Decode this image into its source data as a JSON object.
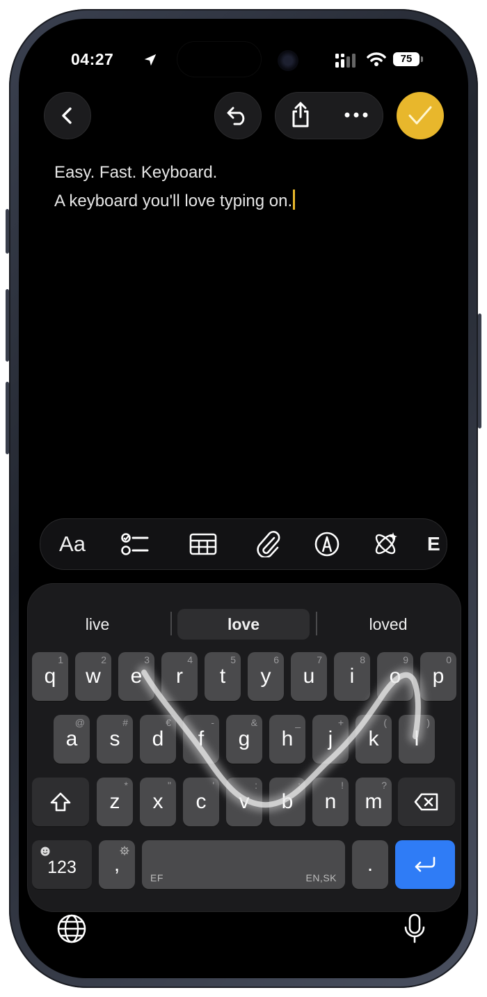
{
  "status_bar": {
    "time": "04:27",
    "battery": "75"
  },
  "nav": {
    "back_label": "Back",
    "undo_label": "Undo",
    "share_label": "Share",
    "more_label": "More",
    "done_label": "Done"
  },
  "note": {
    "line1": "Easy. Fast. Keyboard.",
    "line2": "A keyboard you'll love typing on."
  },
  "format_toolbar": {
    "text_style": "Aa",
    "items": [
      "checklist-icon",
      "table-icon",
      "attachment-icon",
      "markup-icon",
      "apple-intelligence-icon",
      "more-cut-icon"
    ]
  },
  "suggestions": [
    {
      "text": "live",
      "selected": false
    },
    {
      "text": "love",
      "selected": true
    },
    {
      "text": "loved",
      "selected": false
    }
  ],
  "keyboard": {
    "row1": [
      {
        "k": "q",
        "alt": "1"
      },
      {
        "k": "w",
        "alt": "2"
      },
      {
        "k": "e",
        "alt": "3"
      },
      {
        "k": "r",
        "alt": "4"
      },
      {
        "k": "t",
        "alt": "5"
      },
      {
        "k": "y",
        "alt": "6"
      },
      {
        "k": "u",
        "alt": "7"
      },
      {
        "k": "i",
        "alt": "8"
      },
      {
        "k": "o",
        "alt": "9"
      },
      {
        "k": "p",
        "alt": "0"
      }
    ],
    "row2": [
      {
        "k": "a",
        "alt": "@"
      },
      {
        "k": "s",
        "alt": "#"
      },
      {
        "k": "d",
        "alt": "€"
      },
      {
        "k": "f",
        "alt": "-"
      },
      {
        "k": "g",
        "alt": "&"
      },
      {
        "k": "h",
        "alt": "_"
      },
      {
        "k": "j",
        "alt": "+"
      },
      {
        "k": "k",
        "alt": "("
      },
      {
        "k": "l",
        "alt": ")"
      }
    ],
    "row3": [
      {
        "k": "z",
        "alt": "*"
      },
      {
        "k": "x",
        "alt": "\""
      },
      {
        "k": "c",
        "alt": "'"
      },
      {
        "k": "v",
        "alt": ":"
      },
      {
        "k": "b",
        "alt": ";"
      },
      {
        "k": "n",
        "alt": "!"
      },
      {
        "k": "m",
        "alt": "?"
      }
    ],
    "numbers_label": "123",
    "comma_label": ",",
    "space_left_label": "EF",
    "space_right_label": "EN,SK",
    "period_label": ".",
    "accent_color": "#2f7cf6"
  },
  "colors": {
    "done_accent": "#e8b72c",
    "key": "#4a4a4c",
    "key_dark": "#2e2e30"
  }
}
